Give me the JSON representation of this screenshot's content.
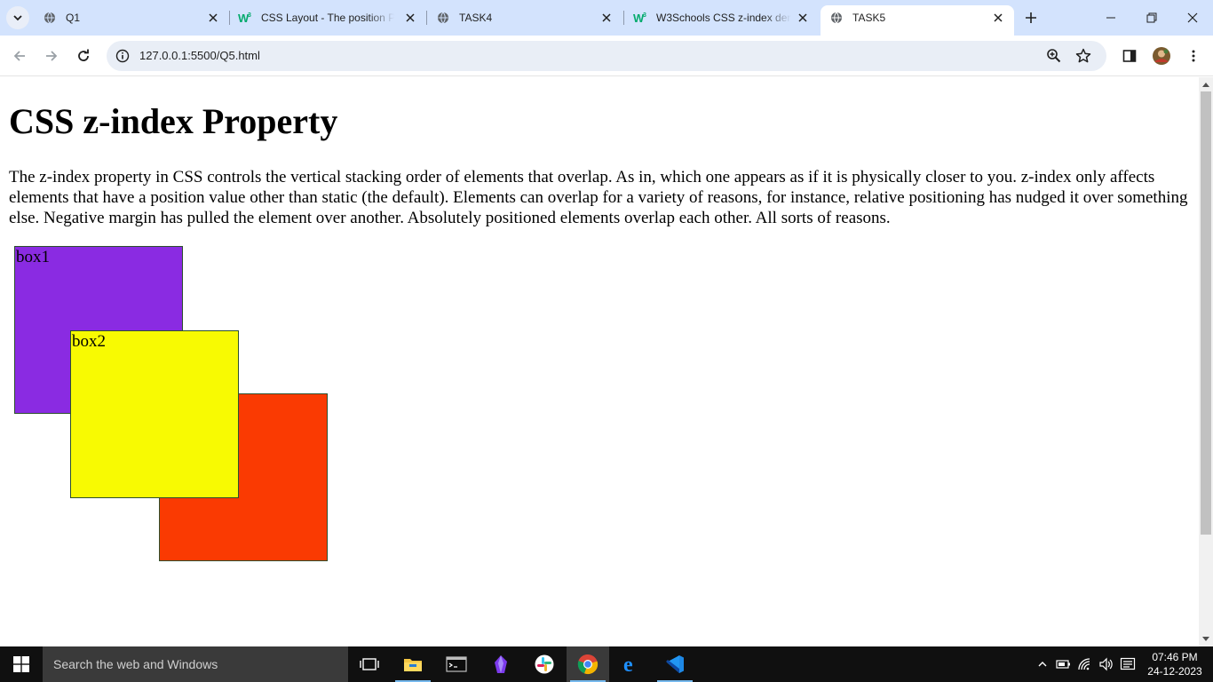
{
  "browser": {
    "tabs": [
      {
        "title": "Q1",
        "favicon": "globe-icon",
        "active": false
      },
      {
        "title": "CSS Layout - The position Pr",
        "favicon": "w3schools-icon",
        "active": false
      },
      {
        "title": "TASK4",
        "favicon": "globe-icon",
        "active": false
      },
      {
        "title": "W3Schools CSS z-index dem",
        "favicon": "w3schools-icon",
        "active": false
      },
      {
        "title": "TASK5",
        "favicon": "globe-icon",
        "active": true
      }
    ],
    "url": "127.0.0.1:5500/Q5.html",
    "colors": {
      "tabstrip": "#d3e3fd",
      "omnibox": "#e9eef6",
      "w3schools_green": "#04aa6d"
    }
  },
  "page": {
    "heading": "CSS z-index Property",
    "paragraph": "The z-index property in CSS controls the vertical stacking order of elements that overlap. As in, which one appears as if it is physically closer to you. z-index only affects elements that have a position value other than static (the default). Elements can overlap for a variety of reasons, for instance, relative positioning has nudged it over something else. Negative margin has pulled the element over another. Absolutely positioned elements overlap each other. All sorts of reasons.",
    "boxes": [
      {
        "label": "box1",
        "color": "#8a2be2"
      },
      {
        "label": "box2",
        "color": "#f8fa02"
      },
      {
        "label": "",
        "color": "#fa3a02"
      }
    ]
  },
  "taskbar": {
    "search_placeholder": "Search the web and Windows",
    "apps": [
      "task-view-icon",
      "file-explorer-icon",
      "terminal-icon",
      "obsidian-icon",
      "slack-icon",
      "chrome-icon",
      "edge-icon",
      "vscode-icon"
    ],
    "time": "07:46 PM",
    "date": "24-12-2023"
  }
}
